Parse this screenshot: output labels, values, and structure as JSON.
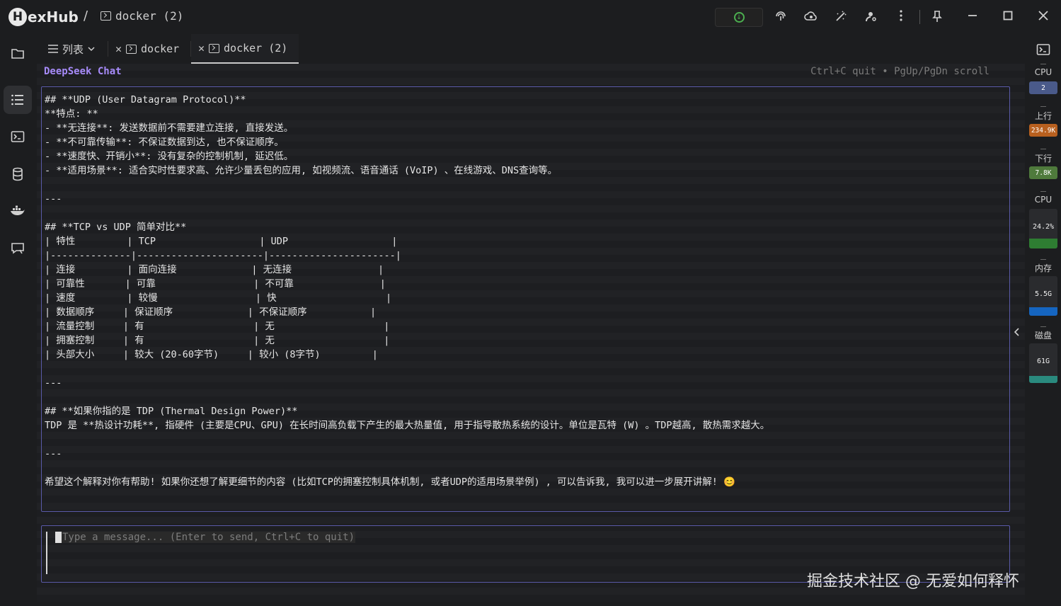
{
  "app": {
    "logo_text": "exHub",
    "logo_mark": "H",
    "crumb_sep": "/",
    "crumb_title": "docker (2)"
  },
  "tabs": [
    {
      "label": "列表",
      "icon": "list-icon",
      "closable": false,
      "dropdown": true
    },
    {
      "label": "docker",
      "icon": "terminal-icon",
      "closable": true
    },
    {
      "label": "docker (2)",
      "icon": "terminal-icon",
      "closable": true,
      "active": true
    }
  ],
  "chat": {
    "title": "DeepSeek Chat",
    "hint": "Ctrl+C quit • PgUp/PgDn scroll",
    "lines": [
      "## **UDP (User Datagram Protocol)**",
      "**特点: **",
      "- **无连接**: 发送数据前不需要建立连接, 直接发送。",
      "- **不可靠传输**: 不保证数据到达, 也不保证顺序。",
      "- **速度快、开销小**: 没有复杂的控制机制, 延迟低。",
      "- **适用场景**: 适合实时性要求高、允许少量丢包的应用, 如视频流、语音通话 (VoIP) 、在线游戏、DNS查询等。",
      "",
      "---",
      "",
      "## **TCP vs UDP 简单对比**",
      "| 特性         | TCP                  | UDP                  |",
      "|--------------|----------------------|----------------------|",
      "| 连接         | 面向连接             | 无连接               |",
      "| 可靠性       | 可靠                 | 不可靠               |",
      "| 速度         | 较慢                 | 快                   |",
      "| 数据顺序     | 保证顺序             | 不保证顺序           |",
      "| 流量控制     | 有                   | 无                   |",
      "| 拥塞控制     | 有                   | 无                   |",
      "| 头部大小     | 较大 (20-60字节)     | 较小 (8字节)         |",
      "",
      "---",
      "",
      "## **如果你指的是 TDP (Thermal Design Power)**",
      "TDP 是 **热设计功耗**, 指硬件 (主要是CPU、GPU) 在长时间高负载下产生的最大热量值, 用于指导散热系统的设计。单位是瓦特 (W) 。TDP越高, 散热需求越大。",
      "",
      "---",
      "",
      "希望这个解释对你有帮助! 如果你还想了解更细节的内容 (比如TCP的拥塞控制具体机制, 或者UDP的适用场景举例) , 可以告诉我, 我可以进一步展开讲解! 😊"
    ],
    "input_placeholder": "Type a message... (Enter to send, Ctrl+C to quit)"
  },
  "monitor": {
    "cpu_cores_label": "CPU",
    "cpu_cores_value": "2",
    "upload_label": "上行",
    "upload_value": "234.9K",
    "download_label": "下行",
    "download_value": "7.8K",
    "cpu_label": "CPU",
    "cpu_value": "24.2%",
    "cpu_fraction": 0.242,
    "mem_label": "内存",
    "mem_value": "5.5G",
    "mem_fraction": 0.22,
    "disk_label": "磁盘",
    "disk_value": "61G",
    "disk_fraction": 0.18,
    "colors": {
      "cpu_cores": "#4a5a8a",
      "upload": "#b8601f",
      "download": "#4f7a3c",
      "cpu": "#2e7d32",
      "mem": "#1565c0",
      "disk": "#2a8a7e"
    }
  },
  "watermark": "掘金技术社区 @ 无爱如何释怀"
}
